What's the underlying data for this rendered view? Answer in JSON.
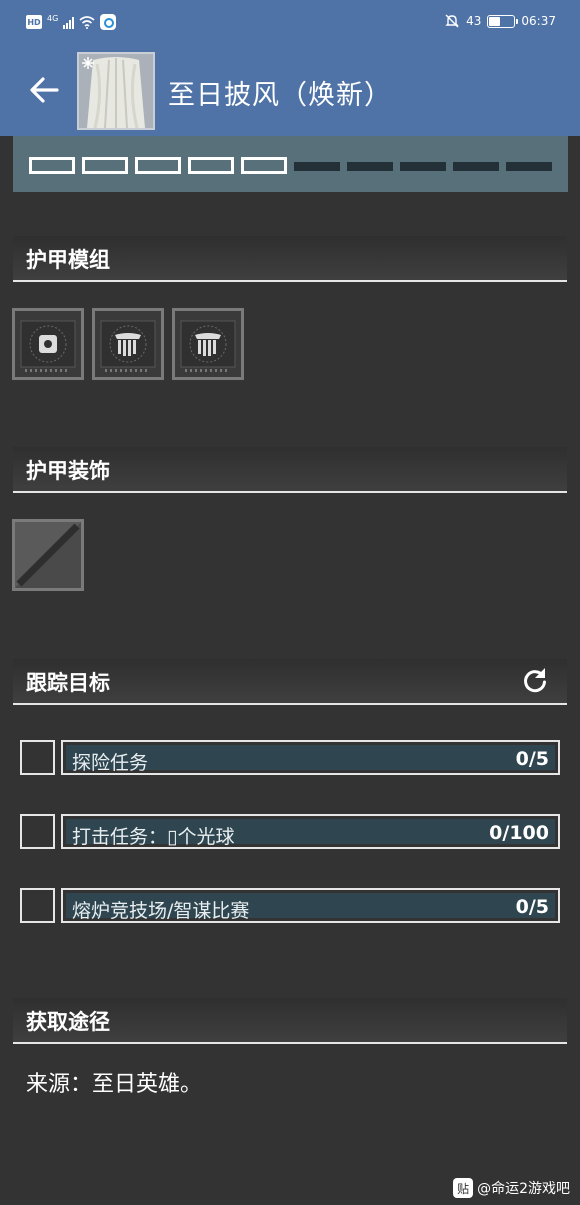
{
  "status_bar": {
    "hd": "HD",
    "network": "4G",
    "battery": "43",
    "time": "06:37"
  },
  "header": {
    "title": "至日披风（焕新）",
    "back_icon": "arrow-left-icon"
  },
  "progress": {
    "total": 10,
    "filled": 5
  },
  "sections": {
    "mods": {
      "title": "护甲模组"
    },
    "ornament": {
      "title": "护甲装饰"
    },
    "tracking": {
      "title": "跟踪目标",
      "refresh_icon": "refresh-icon"
    },
    "source": {
      "title": "获取途径"
    }
  },
  "mod_slots": [
    {
      "icon": "gear-socket-icon"
    },
    {
      "icon": "armor-socket-icon"
    },
    {
      "icon": "armor-socket-icon"
    }
  ],
  "objectives": [
    {
      "label": "探险任务",
      "progress": "0/5"
    },
    {
      "label": "打击任务：▯个光球",
      "progress": "0/100"
    },
    {
      "label": "熔炉竞技场/智谋比赛",
      "progress": "0/5"
    }
  ],
  "source_text": "来源：至日英雄。",
  "watermark": {
    "icon": "贴",
    "text": "@命运2游戏吧"
  },
  "colors": {
    "header": "#4f73a6",
    "background": "#333333",
    "progress_strip": "#57707a",
    "objective_fill": "#2f4650"
  }
}
